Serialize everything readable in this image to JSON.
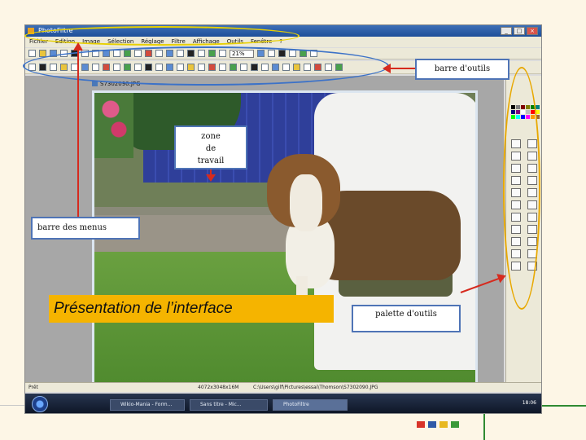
{
  "window": {
    "title": "PhotoFiltre",
    "buttons": [
      "_",
      "□",
      "×"
    ]
  },
  "menubar": {
    "items": [
      "Fichier",
      "Edition",
      "Image",
      "Sélection",
      "Réglage",
      "Filtre",
      "Affichage",
      "Outils",
      "Fenêtre",
      "?"
    ]
  },
  "toolbar": {
    "zoom": "21%"
  },
  "document": {
    "title": "S7302090.JPG"
  },
  "statusbar": {
    "left": "Prêt",
    "size": "4072x3048x16M",
    "path": "C:\\Users\\gilf\\Pictures\\essai\\Thomson\\S7302090.JPG"
  },
  "taskbar": {
    "items": [
      "Wikio-Mania - Form...",
      "Sans titre - Mic...",
      "PhotoFiltre"
    ],
    "active": "PhotoFiltre",
    "time": "18:06"
  },
  "annotations": {
    "barre_outils": "barre d'outils",
    "zone_line1": "zone",
    "zone_line2": "de",
    "zone_line3": "travail",
    "barre_menus": "barre des menus",
    "palette_outils": "palette d'outils",
    "presentation": "Présentation de l’interface"
  },
  "colors": {
    "accent_orange": "#f5b400",
    "callout_border": "#4f74b6",
    "arrow_red": "#d62a1e",
    "slide_green": "#2f8a32"
  }
}
